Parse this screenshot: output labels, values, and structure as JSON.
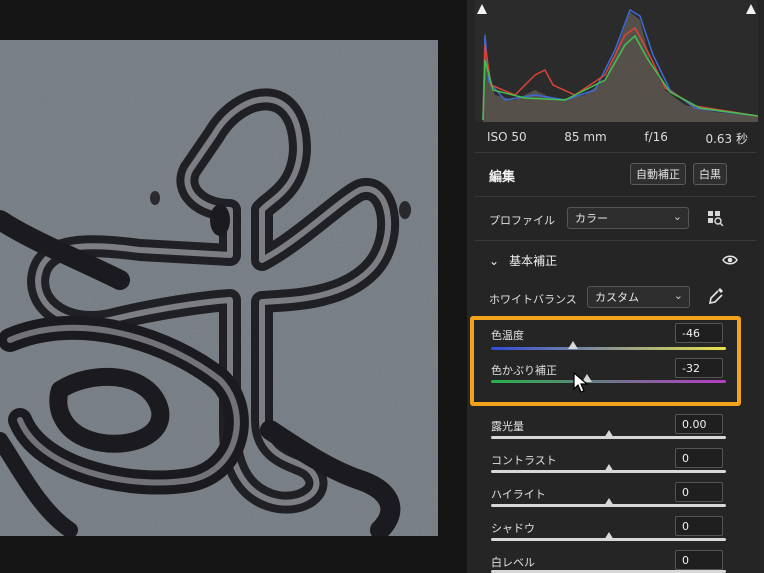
{
  "exif": {
    "iso": "ISO 50",
    "focal": "85 mm",
    "aperture": "f/16",
    "shutter": "0.63 秒"
  },
  "edit": {
    "title": "編集",
    "auto_label": "自動補正",
    "bw_label": "白黒"
  },
  "profile": {
    "label": "プロファイル",
    "value": "カラー"
  },
  "basic": {
    "title": "基本補正",
    "white_balance_label": "ホワイトバランス",
    "white_balance_value": "カスタム"
  },
  "sliders": {
    "temperature": {
      "label": "色温度",
      "value": "-46",
      "level": 0.35
    },
    "tint": {
      "label": "色かぶり補正",
      "value": "-32",
      "level": 0.41
    },
    "exposure": {
      "label": "露光量",
      "value": "0.00",
      "level": 0.5
    },
    "contrast": {
      "label": "コントラスト",
      "value": "0",
      "level": 0.5
    },
    "highlights": {
      "label": "ハイライト",
      "value": "0",
      "level": 0.5
    },
    "shadows": {
      "label": "シャドウ",
      "value": "0",
      "level": 0.5
    },
    "whites": {
      "label": "白レベル",
      "value": "0",
      "level": 0.5
    }
  },
  "colors": {
    "highlight": "#f3a21b",
    "panel": "#252525"
  }
}
